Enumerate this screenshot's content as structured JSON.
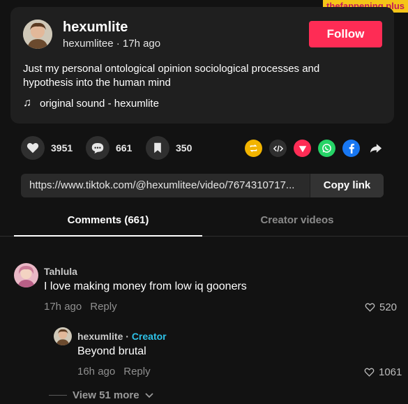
{
  "watermark": "thefappening.plus",
  "post": {
    "author_name": "hexumlite",
    "author_handle": "hexumlitee",
    "time_ago": "17h ago",
    "follow_label": "Follow",
    "caption": "Just my personal ontological opinion sociological processes and hypothesis into the human mind",
    "sound": "original sound - hexumlite"
  },
  "actions": {
    "likes": "3951",
    "comments": "661",
    "saves": "350"
  },
  "share_icons": [
    "repost-icon",
    "embed-icon",
    "send-icon",
    "whatsapp-icon",
    "facebook-icon",
    "share-arrow-icon"
  ],
  "link": {
    "url": "https://www.tiktok.com/@hexumlitee/video/7674310717...",
    "copy_label": "Copy link"
  },
  "tabs": {
    "comments": "Comments (661)",
    "creator_videos": "Creator videos"
  },
  "comments": [
    {
      "user": "Tahlula",
      "text": "I love making money from low iq gooners",
      "time": "17h ago",
      "reply_label": "Reply",
      "likes": "520"
    }
  ],
  "reply": {
    "user": "hexumlite",
    "separator": "·",
    "badge": "Creator",
    "text": "Beyond brutal",
    "time": "16h ago",
    "reply_label": "Reply",
    "likes": "1061"
  },
  "view_more": "View 51 more",
  "colors": {
    "follow": "#fe2c55",
    "creator_badge": "#2ec2e8",
    "repost": "#f2b400",
    "send": "#fe2c55",
    "whatsapp": "#25d366",
    "facebook": "#1877f2"
  }
}
